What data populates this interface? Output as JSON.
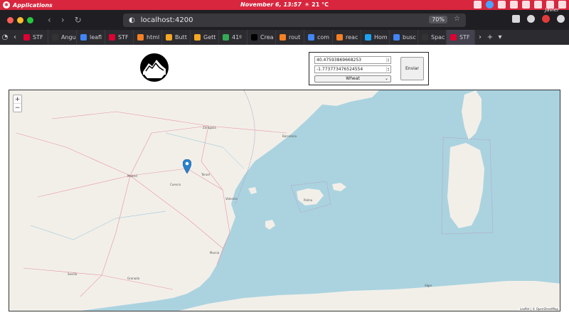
{
  "system_bar": {
    "applications_label": "Applications",
    "clock": "November  6, 13:57",
    "weather": "21 °C",
    "user": "Javier"
  },
  "browser": {
    "url": "localhost:4200",
    "zoom": "70%",
    "tabs": [
      {
        "label": "STF",
        "icon": "angular-icon",
        "color": "#dd0031"
      },
      {
        "label": "Angu",
        "icon": "github-icon",
        "color": "#333333"
      },
      {
        "label": "leafl",
        "icon": "google-icon",
        "color": "#4285f4"
      },
      {
        "label": "STF",
        "icon": "angular-icon",
        "color": "#dd0031"
      },
      {
        "label": "html",
        "icon": "stackoverflow-icon",
        "color": "#f48024"
      },
      {
        "label": "Butt",
        "icon": "shield-icon",
        "color": "#f5a623"
      },
      {
        "label": "Gett",
        "icon": "shield-icon",
        "color": "#f5a623"
      },
      {
        "label": "41º",
        "icon": "maps-icon",
        "color": "#34a853"
      },
      {
        "label": "Crea",
        "icon": "medium-icon",
        "color": "#000000"
      },
      {
        "label": "rout",
        "icon": "stackoverflow-icon",
        "color": "#f48024"
      },
      {
        "label": "com",
        "icon": "google-icon",
        "color": "#4285f4"
      },
      {
        "label": "reac",
        "icon": "stackoverflow-icon",
        "color": "#f48024"
      },
      {
        "label": "Hom",
        "icon": "twitter-icon",
        "color": "#1da1f2"
      },
      {
        "label": "busc",
        "icon": "google-icon",
        "color": "#4285f4"
      },
      {
        "label": "Spac",
        "icon": "github-icon",
        "color": "#333333"
      },
      {
        "label": "STF",
        "icon": "angular-icon",
        "color": "#dd0031",
        "active": true
      }
    ]
  },
  "form": {
    "latitude": "40.47593869668253",
    "longitude": "-1.773773476524554",
    "crop_select": "Wheat",
    "submit_label": "Enviar"
  },
  "map": {
    "zoom_in": "+",
    "zoom_out": "−",
    "attribution": "Leaflet | © OpenStreetMap",
    "marker_position": {
      "lat": 40.47593869668253,
      "lng": -1.773773476524554
    },
    "labels": [
      "Zaragoza",
      "Barcelona",
      "Madrid",
      "Valencia",
      "Murcia",
      "Sevilla",
      "Granada",
      "Cuenca",
      "Teruel",
      "Palma",
      "Alger"
    ]
  },
  "colors": {
    "system_bar": "#d7263d",
    "map_sea": "#aad3df",
    "map_land": "#f2efe9",
    "marker": "#2a81cb"
  }
}
